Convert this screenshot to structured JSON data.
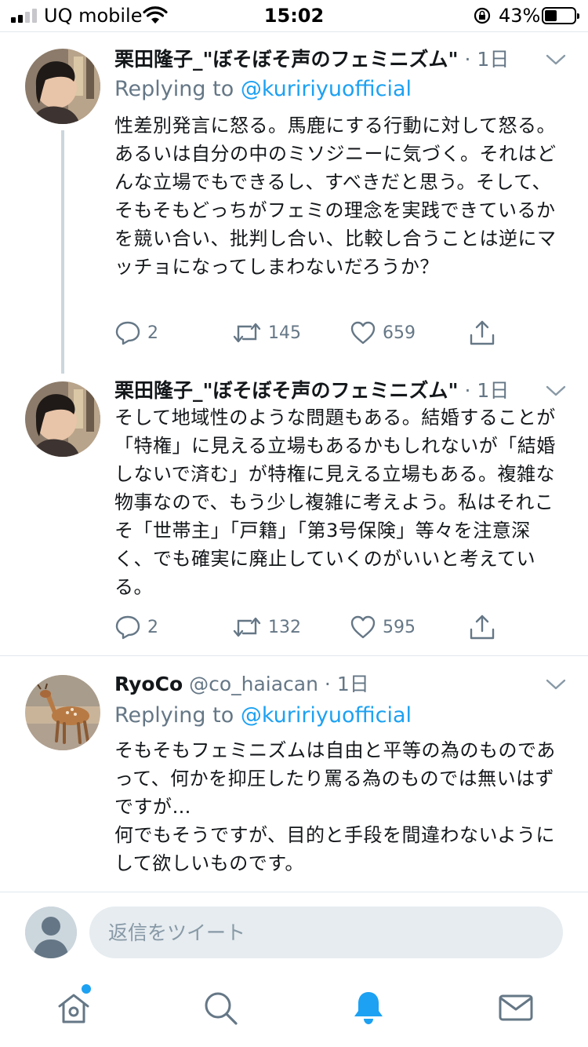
{
  "status_bar": {
    "carrier": "UQ mobile",
    "time": "15:02",
    "battery_percent": "43%",
    "battery_level": 0.43,
    "signal_bars_filled": 2
  },
  "tweets": [
    {
      "name": "栗田隆子_\"ぼそぼそ声のフェミニズム\"",
      "separator": "·",
      "time": "1日",
      "replying_prefix": "Replying to",
      "replying_to": "@kuririyuofficial",
      "text": "性差別発言に怒る。馬鹿にする行動に対して怒る。あるいは自分の中のミソジニーに気づく。それはどんな立場でもできるし、すべきだと思う。そして、そもそもどっちがフェミの理念を実践できているかを競い合い、批判し合い、比較し合うことは逆にマッチョになってしまわないだろうか？",
      "replies": "2",
      "retweets": "145",
      "likes": "659"
    },
    {
      "name": "栗田隆子_\"ぼそぼそ声のフェミニズム\"",
      "separator": "·",
      "time": "1日",
      "text": "そして地域性のような問題もある。結婚することが「特権」に見える立場もあるかもしれないが「結婚しないで済む」が特権に見える立場もある。複雑な物事なので、もう少し複雑に考えよう。私はそれこそ「世帯主」「戸籍」「第3号保険」等々を注意深く、でも確実に廃止していくのがいいと考えている。",
      "replies": "2",
      "retweets": "132",
      "likes": "595"
    },
    {
      "name": "RyoCo",
      "handle": "@co_haiacan",
      "separator": "·",
      "time": "1日",
      "replying_prefix": "Replying to",
      "replying_to": "@kuririyuofficial",
      "text": "そもそもフェミニズムは自由と平等の為のものであって、何かを抑圧したり罵る為のものでは無いはずですが…\n何でもそうですが、目的と手段を間違わないようにして欲しいものです。"
    }
  ],
  "composer": {
    "placeholder": "返信をツイート"
  },
  "tabbar": {
    "active_tab": "notifications",
    "home_has_new": true
  },
  "colors": {
    "accent": "#1da1f2",
    "secondary_text": "#657786",
    "primary_text": "#14171a",
    "divider": "#e1e8ed"
  },
  "icons": [
    "reply-icon",
    "retweet-icon",
    "like-icon",
    "share-icon",
    "chevron-down-icon",
    "home-icon",
    "search-icon",
    "bell-icon",
    "mail-icon"
  ]
}
